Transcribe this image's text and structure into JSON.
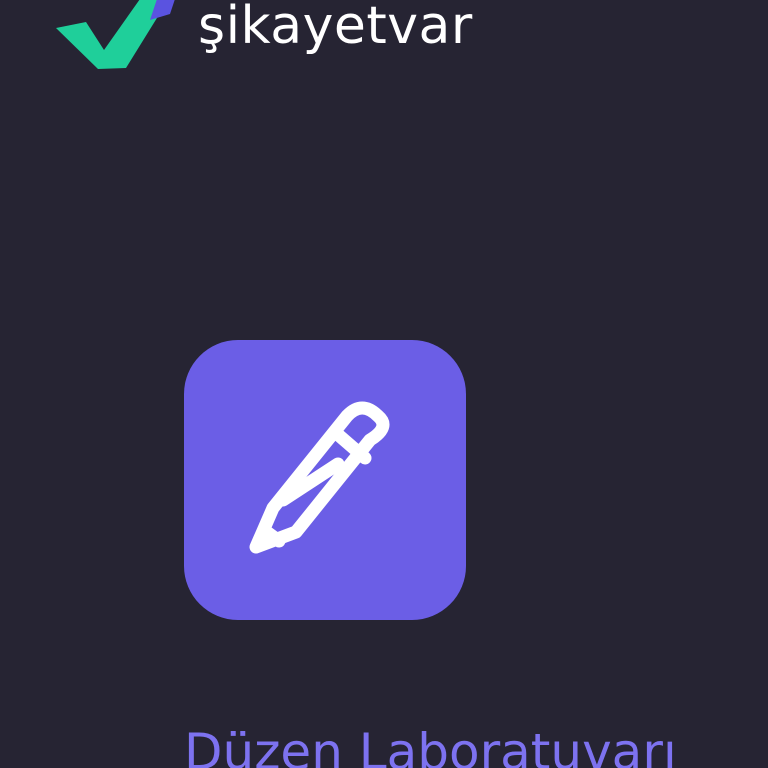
{
  "header": {
    "brand_name": "şikayetvar",
    "logo_icon": "checkmark-logo-icon",
    "colors": {
      "check_green": "#1fcf9a",
      "check_blue": "#5a53e0"
    }
  },
  "card": {
    "icon": "pencil-icon",
    "tile_color": "#6b5ee6",
    "icon_color": "#ffffff",
    "company_name": "Düzen Laboratuvarı",
    "company_name_color": "#7d72f0"
  },
  "page": {
    "background": "#262433"
  }
}
